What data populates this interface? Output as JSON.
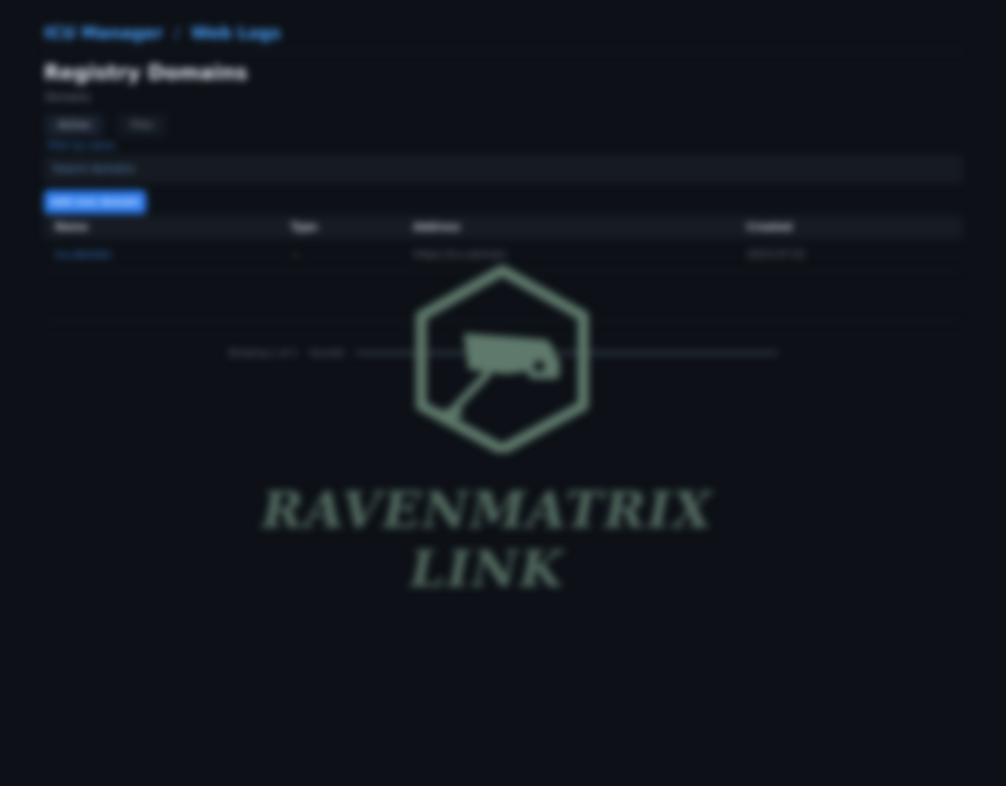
{
  "app": {
    "breadcrumb": [
      "ICU Manager",
      "Web Logs"
    ],
    "breadcrumb_sep": "/"
  },
  "page": {
    "title": "Registry Domains",
    "subtitle": "Domains",
    "tabs": [
      "Active",
      "Files"
    ],
    "active_tab": 0,
    "filter_label": "Filter by name",
    "filter_placeholder": "Search domains",
    "primary_button": "Add new domain"
  },
  "table": {
    "headers": [
      "Name",
      "Type",
      "Address",
      "Created"
    ],
    "rows": [
      [
        "icu.domain",
        "—",
        "https://icu.domain",
        "2023-07-01"
      ]
    ]
  },
  "footer": {
    "label": "Showing 1 of 1",
    "sub": "records"
  },
  "watermark": {
    "text": "RAVENMATRIX LINK",
    "icon": "camera-icon"
  },
  "colors": {
    "background": "#0d1117",
    "accent": "#2f7ef0",
    "link": "#3f86e0",
    "watermark": "#5f7a6c"
  }
}
